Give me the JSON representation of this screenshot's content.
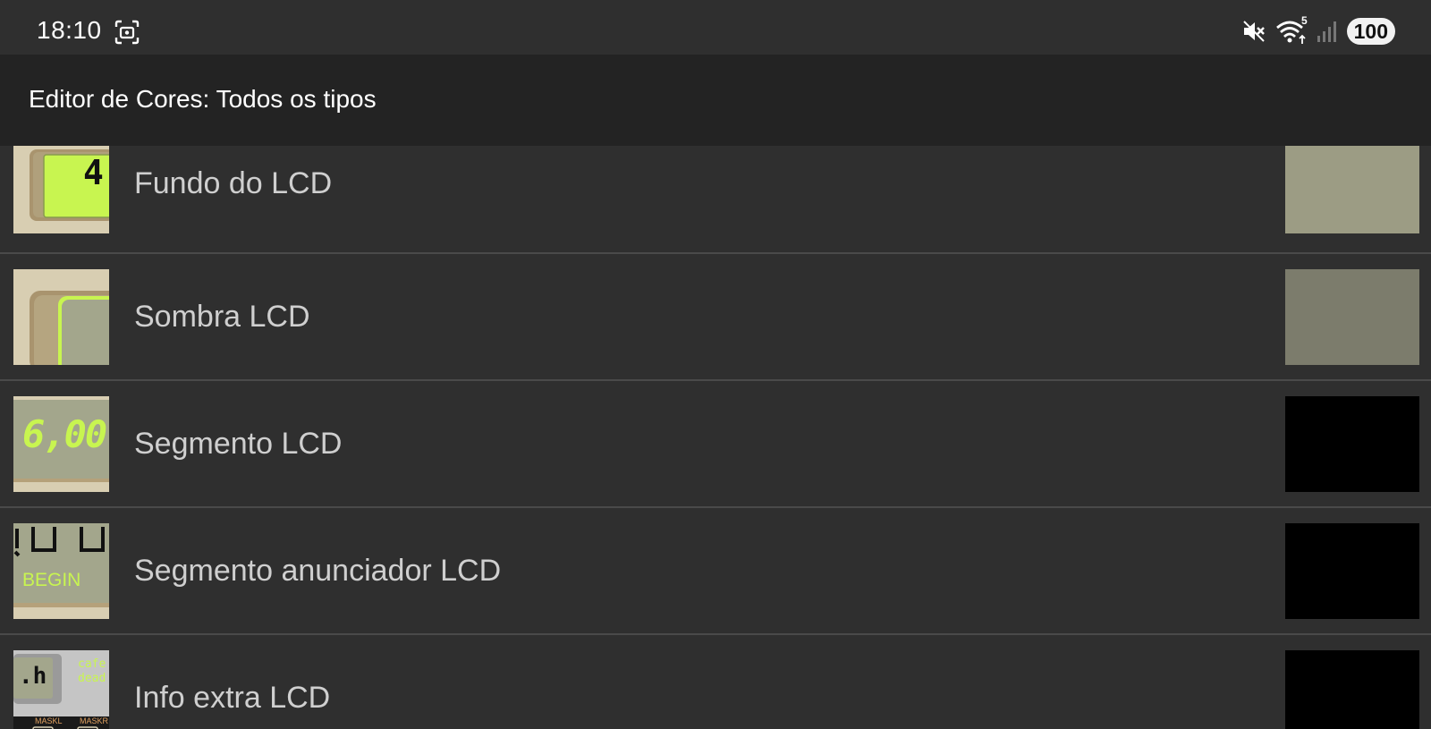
{
  "status_bar": {
    "time": "18:10",
    "icons": [
      "screenshot-icon",
      "mute-icon",
      "wifi-icon",
      "signal-icon"
    ],
    "wifi_badge": "5",
    "battery": "100"
  },
  "app_bar": {
    "title": "Editor de Cores: Todos os tipos"
  },
  "items": [
    {
      "label": "Fundo do LCD",
      "swatch_color": "#9c9c84",
      "thumb_text": "4,"
    },
    {
      "label": "Sombra LCD",
      "swatch_color": "#7c7c6c"
    },
    {
      "label": "Segmento LCD",
      "swatch_color": "#000000",
      "thumb_text": "6,00"
    },
    {
      "label": "Segmento anunciador LCD",
      "swatch_color": "#000000",
      "thumb_text": "BEGIN"
    },
    {
      "label": "Info extra LCD",
      "swatch_color": "#000000",
      "thumb_lines": [
        "cafe",
        "dead"
      ],
      "thumb_small": [
        "MASKL",
        "MASKR"
      ],
      "thumb_glyph": ".h"
    }
  ],
  "colors": {
    "background": "#2f2f2f",
    "app_bar": "#232323",
    "lcd_green": "#c8f550",
    "lcd_grey": "#a3a68c",
    "bezel": "#d8ceb2"
  }
}
